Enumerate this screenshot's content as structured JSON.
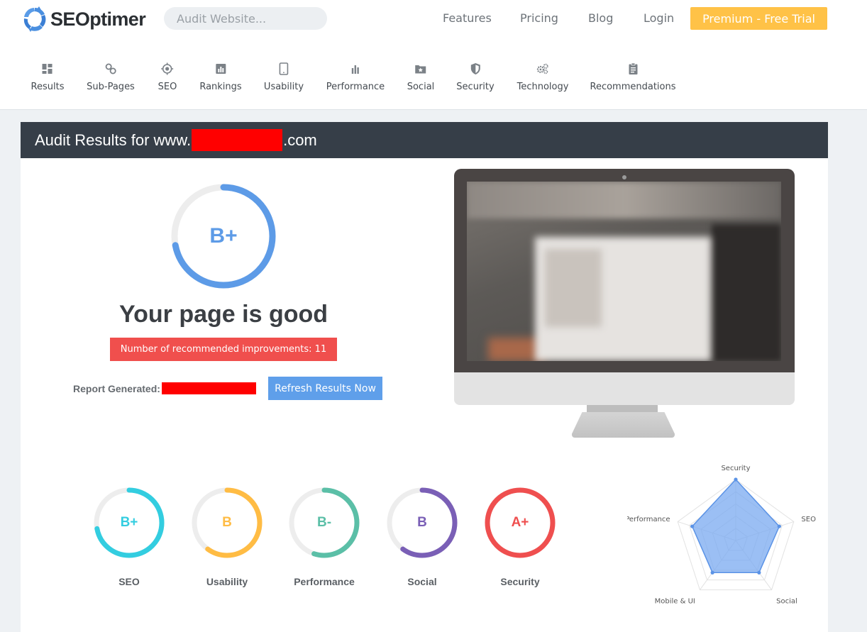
{
  "brand": {
    "name": "SEOptimer"
  },
  "search": {
    "placeholder": "Audit Website..."
  },
  "topnav": {
    "features": "Features",
    "pricing": "Pricing",
    "blog": "Blog",
    "login": "Login",
    "cta": "Premium - Free Trial"
  },
  "subnav": [
    {
      "label": "Results",
      "icon": "dashboard-icon"
    },
    {
      "label": "Sub-Pages",
      "icon": "link-icon"
    },
    {
      "label": "SEO",
      "icon": "target-icon"
    },
    {
      "label": "Rankings",
      "icon": "bar-chart-icon"
    },
    {
      "label": "Usability",
      "icon": "tablet-icon"
    },
    {
      "label": "Performance",
      "icon": "bars-icon"
    },
    {
      "label": "Social",
      "icon": "folder-star-icon"
    },
    {
      "label": "Security",
      "icon": "shield-icon"
    },
    {
      "label": "Technology",
      "icon": "cogs-icon"
    },
    {
      "label": "Recommendations",
      "icon": "clipboard-icon"
    }
  ],
  "audit": {
    "title_prefix": "Audit Results for www.",
    "title_suffix": ".com",
    "overall_grade": "B+",
    "overall_score": 0.72,
    "verdict": "Your page is good",
    "improvements_label": "Number of recommended improvements: 11",
    "report_label": "Report Generated:",
    "refresh_label": "Refresh Results Now"
  },
  "categories": [
    {
      "grade": "B+",
      "label": "SEO",
      "color": "#33cde0",
      "score": 0.72
    },
    {
      "grade": "B",
      "label": "Usability",
      "color": "#ffbc44",
      "score": 0.6
    },
    {
      "grade": "B-",
      "label": "Performance",
      "color": "#5bbfa7",
      "score": 0.55
    },
    {
      "grade": "B",
      "label": "Social",
      "color": "#7a5fb6",
      "score": 0.6
    },
    {
      "grade": "A+",
      "label": "Security",
      "color": "#ef4f4f",
      "score": 1.0
    }
  ],
  "radar": {
    "axes": [
      "Security",
      "SEO",
      "Social",
      "Mobile & UI",
      "Performance"
    ],
    "values": [
      1.0,
      0.75,
      0.65,
      0.65,
      0.75
    ],
    "max": 1.0,
    "fill": "#7aaaf0",
    "stroke": "#5b93e6"
  },
  "colors": {
    "accent": "#5d9be7",
    "header_bg": "#363e48",
    "cta": "#ffc247",
    "alert": "#f04f4d",
    "redaction": "#ff0000"
  }
}
